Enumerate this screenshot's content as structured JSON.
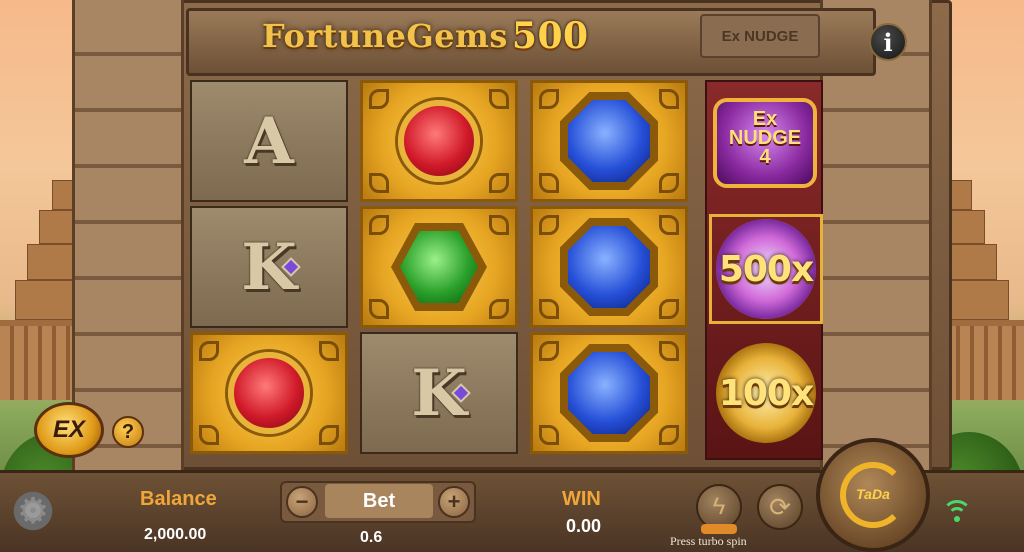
{
  "game": {
    "title_text": "FortuneGems",
    "title_number": "500",
    "nudge_plaque": "Ex NUDGE"
  },
  "reels": [
    [
      "letter-A",
      "letter-K",
      "ruby"
    ],
    [
      "ruby",
      "emerald",
      "letter-K"
    ],
    [
      "sapphire",
      "sapphire",
      "sapphire"
    ]
  ],
  "symbols": {
    "A": "A",
    "K": "K"
  },
  "special_reel": {
    "ex_nudge_line1": "Ex",
    "ex_nudge_line2": "NUDGE",
    "ex_nudge_count": "4",
    "multiplier_1": "500x",
    "multiplier_2": "100x"
  },
  "ex_button": {
    "label": "EX",
    "help": "?"
  },
  "bottom_bar": {
    "balance_label": "Balance",
    "balance_value": "2,000.00",
    "bet_label": "Bet",
    "bet_value": "0.6",
    "bet_minus": "−",
    "bet_plus": "+",
    "win_label": "WIN",
    "win_value": "0.00",
    "turbo_hint": "Press turbo spin",
    "spin_label": "TaDa"
  },
  "info_button": "i",
  "colors": {
    "accent_gold": "#f0b428",
    "label_orange": "#f0a63a",
    "wifi_green": "#4ad86a"
  },
  "icons": [
    "gear-icon",
    "info-icon",
    "turbo-icon",
    "autoplay-icon",
    "wifi-icon",
    "spin-icon"
  ]
}
